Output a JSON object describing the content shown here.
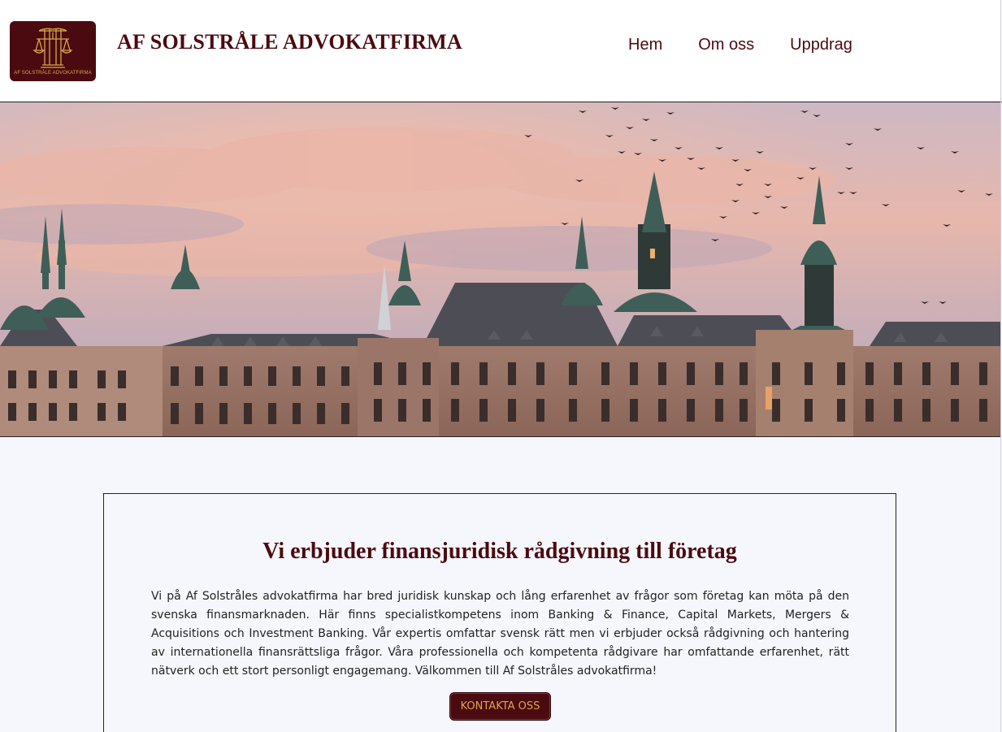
{
  "header": {
    "logo_caption": "AF SOLSTRÅLE ADVOKATFIRMA",
    "brand_name": "AF SOLSTRÅLE ADVOKATFIRMA",
    "nav": [
      {
        "label": "Hem"
      },
      {
        "label": "Om oss"
      },
      {
        "label": "Uppdrag"
      }
    ]
  },
  "hero": {
    "icon": "stockholm-skyline-photo"
  },
  "intro": {
    "title": "Vi erbjuder finansjuridisk rådgivning till företag",
    "body": "Vi på Af Solstråles advokatfirma har bred juridisk kunskap och lång erfarenhet av frågor som företag kan möta på den svenska finansmarknaden. Här finns specialistkompetens inom Banking & Finance, Capital Markets, Mergers & Acquisitions och Investment Banking. Vår expertis omfattar svensk rätt men vi erbjuder också rådgivning och hantering av internationella finansrättsliga frågor. Våra professionella och kompetenta rådgivare har omfattande erfarenhet, rätt nätverk och ett stort personligt engagemang. Välkommen till Af Solstråles advokatfirma!",
    "cta_label": "KONTAKTA OSS"
  },
  "colors": {
    "brand": "#4b0a10",
    "gold": "#d5a84c",
    "page_background": "#f6f7fc"
  }
}
